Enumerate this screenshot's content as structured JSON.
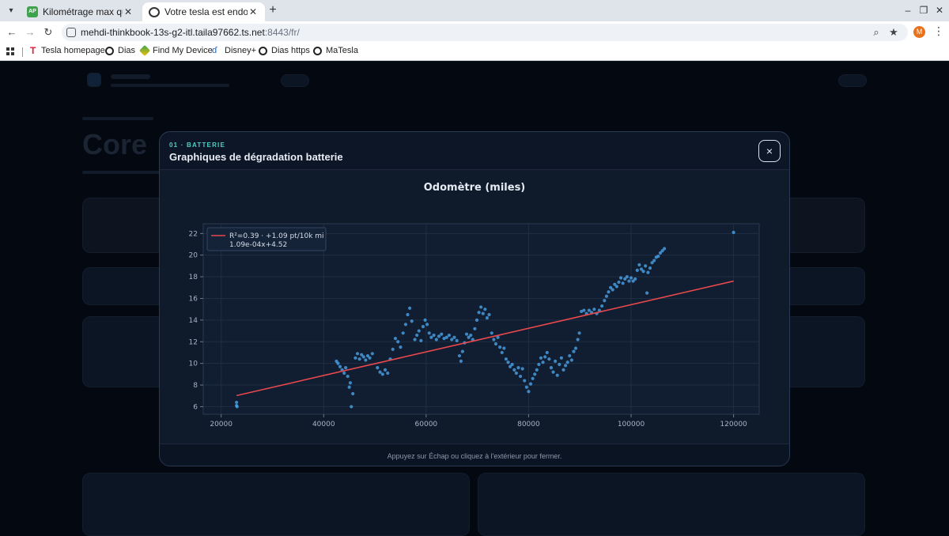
{
  "browser": {
    "tabs": [
      {
        "favicon": "AP",
        "title": "Kilométrage max qu'ind",
        "active": false
      },
      {
        "favicon": "globe-icon",
        "title": "Votre tesla est endormie",
        "active": true
      }
    ],
    "new_tab_label": "+",
    "url": {
      "host": "mehdi-thinkbook-13s-g2-itl.taila97662.ts.net",
      "port_path": ":8443/fr/"
    },
    "profile_initial": "M",
    "bookmarks": [
      {
        "icon": "tesla-icon",
        "label": "Tesla homepage"
      },
      {
        "icon": "globe-icon",
        "label": "Dias"
      },
      {
        "icon": "find-my-device-icon",
        "label": "Find My Device"
      },
      {
        "icon": "disney-icon",
        "label": "Disney+"
      },
      {
        "icon": "globe-icon",
        "label": "Dias https"
      },
      {
        "icon": "globe-icon",
        "label": "MaTesla"
      }
    ]
  },
  "modal": {
    "kicker": "01 · BATTERIE",
    "title": "Graphiques de dégradation batterie",
    "close_label": "×",
    "footer": "Appuyez sur Échap ou cliquez à l'extérieur pour fermer."
  },
  "chart_data": {
    "type": "scatter",
    "title": "Odomètre (miles)",
    "xlabel": "",
    "ylabel": "",
    "xlim": [
      16500,
      125000
    ],
    "ylim": [
      5.3,
      22.9
    ],
    "xticks": [
      20000,
      40000,
      60000,
      80000,
      100000,
      120000
    ],
    "yticks": [
      6,
      8,
      10,
      12,
      14,
      16,
      18,
      20,
      22
    ],
    "grid": true,
    "legend_position": "top-left",
    "legend": {
      "line1": "R²=0.39  ·  +1.09 pt/10k mi",
      "line2": "1.09e-04x+4.52"
    },
    "fit": {
      "slope": 0.000109,
      "intercept": 4.52,
      "x_range": [
        23000,
        120000
      ],
      "color": "#e5484d"
    },
    "point_color": "#4aa3e8",
    "points": [
      [
        23000,
        6.4
      ],
      [
        23000,
        6.1
      ],
      [
        23100,
        6.0
      ],
      [
        42500,
        10.2
      ],
      [
        42800,
        10.0
      ],
      [
        43200,
        9.7
      ],
      [
        43600,
        9.4
      ],
      [
        44000,
        9.1
      ],
      [
        44300,
        9.6
      ],
      [
        44700,
        8.8
      ],
      [
        45000,
        7.8
      ],
      [
        45200,
        8.2
      ],
      [
        45400,
        6.0
      ],
      [
        45700,
        7.2
      ],
      [
        46200,
        10.5
      ],
      [
        46600,
        10.9
      ],
      [
        47000,
        10.4
      ],
      [
        47400,
        10.8
      ],
      [
        47800,
        10.6
      ],
      [
        48200,
        10.3
      ],
      [
        48600,
        10.7
      ],
      [
        49000,
        10.5
      ],
      [
        49500,
        10.9
      ],
      [
        50500,
        9.6
      ],
      [
        51000,
        9.2
      ],
      [
        51500,
        9.0
      ],
      [
        52000,
        9.4
      ],
      [
        52500,
        9.1
      ],
      [
        53000,
        10.4
      ],
      [
        53500,
        11.3
      ],
      [
        54000,
        12.3
      ],
      [
        54500,
        12.0
      ],
      [
        55000,
        11.5
      ],
      [
        55500,
        12.8
      ],
      [
        56000,
        13.6
      ],
      [
        56400,
        14.5
      ],
      [
        56800,
        15.1
      ],
      [
        57200,
        13.9
      ],
      [
        57800,
        12.2
      ],
      [
        58200,
        12.6
      ],
      [
        58600,
        13.0
      ],
      [
        59000,
        12.1
      ],
      [
        59400,
        13.4
      ],
      [
        59800,
        14.0
      ],
      [
        60200,
        13.6
      ],
      [
        60600,
        12.8
      ],
      [
        61000,
        12.4
      ],
      [
        61500,
        12.6
      ],
      [
        62000,
        12.2
      ],
      [
        62500,
        12.5
      ],
      [
        63000,
        12.7
      ],
      [
        63500,
        12.3
      ],
      [
        64000,
        12.4
      ],
      [
        64500,
        12.6
      ],
      [
        65000,
        12.2
      ],
      [
        65500,
        12.4
      ],
      [
        66000,
        12.1
      ],
      [
        66500,
        10.7
      ],
      [
        66800,
        10.2
      ],
      [
        67100,
        11.1
      ],
      [
        67500,
        11.9
      ],
      [
        67900,
        12.7
      ],
      [
        68300,
        12.4
      ],
      [
        68700,
        12.6
      ],
      [
        69100,
        12.2
      ],
      [
        69500,
        13.2
      ],
      [
        69900,
        14.0
      ],
      [
        70300,
        14.7
      ],
      [
        70700,
        15.2
      ],
      [
        71100,
        14.6
      ],
      [
        71500,
        15.0
      ],
      [
        71900,
        14.2
      ],
      [
        72300,
        14.5
      ],
      [
        72800,
        12.8
      ],
      [
        73200,
        12.2
      ],
      [
        73600,
        11.8
      ],
      [
        74000,
        12.4
      ],
      [
        74400,
        11.5
      ],
      [
        74800,
        11.0
      ],
      [
        75200,
        11.4
      ],
      [
        75600,
        10.4
      ],
      [
        76000,
        10.1
      ],
      [
        76400,
        9.7
      ],
      [
        76800,
        9.9
      ],
      [
        77200,
        9.4
      ],
      [
        77600,
        9.1
      ],
      [
        78000,
        9.6
      ],
      [
        78400,
        8.8
      ],
      [
        78800,
        9.5
      ],
      [
        79200,
        8.4
      ],
      [
        79600,
        7.8
      ],
      [
        80000,
        7.4
      ],
      [
        80400,
        8.1
      ],
      [
        80800,
        8.6
      ],
      [
        81200,
        9.0
      ],
      [
        81600,
        9.4
      ],
      [
        82000,
        9.9
      ],
      [
        82400,
        10.5
      ],
      [
        82800,
        10.1
      ],
      [
        83200,
        10.6
      ],
      [
        83600,
        11.0
      ],
      [
        84000,
        10.4
      ],
      [
        84400,
        9.6
      ],
      [
        84800,
        9.2
      ],
      [
        85200,
        10.2
      ],
      [
        85600,
        8.9
      ],
      [
        86000,
        9.9
      ],
      [
        86400,
        10.5
      ],
      [
        86800,
        9.4
      ],
      [
        87200,
        9.8
      ],
      [
        87600,
        10.1
      ],
      [
        88000,
        10.7
      ],
      [
        88400,
        10.3
      ],
      [
        88800,
        11.1
      ],
      [
        89200,
        11.4
      ],
      [
        89600,
        12.2
      ],
      [
        89900,
        12.8
      ],
      [
        90300,
        14.8
      ],
      [
        90800,
        14.9
      ],
      [
        91300,
        14.6
      ],
      [
        91800,
        14.9
      ],
      [
        92300,
        14.7
      ],
      [
        92800,
        15.0
      ],
      [
        93300,
        14.6
      ],
      [
        93800,
        14.9
      ],
      [
        94300,
        15.3
      ],
      [
        94800,
        15.8
      ],
      [
        95200,
        16.2
      ],
      [
        95600,
        16.6
      ],
      [
        96000,
        17.0
      ],
      [
        96400,
        16.8
      ],
      [
        96800,
        17.3
      ],
      [
        97200,
        17.1
      ],
      [
        97600,
        17.5
      ],
      [
        98000,
        17.9
      ],
      [
        98400,
        17.4
      ],
      [
        98800,
        17.8
      ],
      [
        99200,
        18.0
      ],
      [
        99600,
        17.6
      ],
      [
        100000,
        17.9
      ],
      [
        100400,
        17.6
      ],
      [
        100800,
        17.8
      ],
      [
        101200,
        18.6
      ],
      [
        101600,
        19.1
      ],
      [
        102000,
        18.7
      ],
      [
        102400,
        18.5
      ],
      [
        102800,
        19.0
      ],
      [
        103100,
        16.5
      ],
      [
        103300,
        18.4
      ],
      [
        103700,
        18.8
      ],
      [
        104100,
        19.3
      ],
      [
        104500,
        19.5
      ],
      [
        104900,
        19.8
      ],
      [
        105300,
        19.9
      ],
      [
        105700,
        20.2
      ],
      [
        106100,
        20.4
      ],
      [
        106500,
        20.6
      ],
      [
        120000,
        22.1
      ]
    ]
  }
}
